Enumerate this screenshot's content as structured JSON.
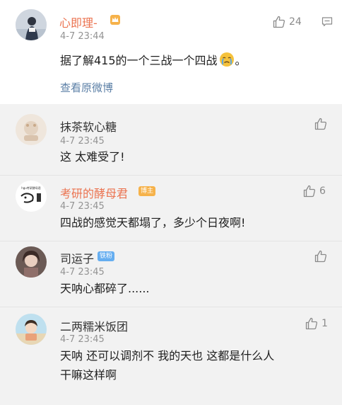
{
  "post": {
    "name": "心即理-",
    "time": "4-7 23:44",
    "text": "据了解415的一个三战一个四战",
    "text_tail": "。",
    "likes": "24",
    "view_original": "查看原微博"
  },
  "replies": [
    {
      "name": "抹茶软心糖",
      "time": "4-7 23:45",
      "text": "这 太难受了!",
      "likes": ""
    },
    {
      "name": "考研的酵母君",
      "badge": "博主",
      "time": "4-7 23:45",
      "text": "四战的感觉天都塌了，多少个日夜啊!",
      "likes": "6",
      "avatar_text": "hgu考研酵母君"
    },
    {
      "name": "司运子",
      "badge": "铁粉",
      "time": "4-7 23:45",
      "text": "天呐心都碎了......",
      "likes": ""
    },
    {
      "name": "二两糯米饭团",
      "time": "4-7 23:45",
      "text_line1": "天呐  还可以调剂不  我的天也  这都是什么人",
      "text_line2": "干嘛这样啊",
      "likes": "1"
    }
  ],
  "colors": {
    "author_orange": "#eb7350",
    "link_blue": "#5b7fa6",
    "reply_background": "#f2f2f2"
  }
}
